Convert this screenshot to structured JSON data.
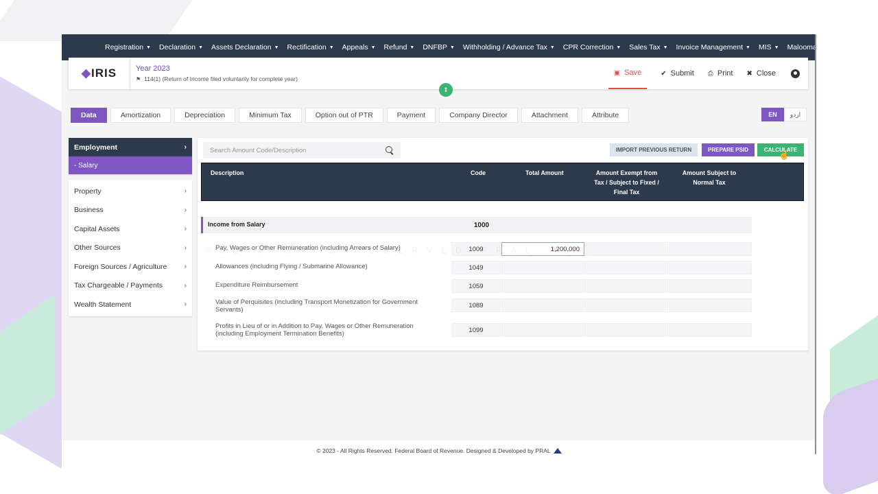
{
  "nav": {
    "items": [
      {
        "label": "Registration"
      },
      {
        "label": "Declaration"
      },
      {
        "label": "Assets Declaration"
      },
      {
        "label": "Rectification"
      },
      {
        "label": "Appeals"
      },
      {
        "label": "Refund"
      },
      {
        "label": "DNFBP"
      },
      {
        "label": "Withholding / Advance Tax"
      },
      {
        "label": "CPR Correction"
      },
      {
        "label": "Sales Tax"
      },
      {
        "label": "Invoice Management"
      },
      {
        "label": "MIS"
      },
      {
        "label": "Maloomat"
      }
    ]
  },
  "header": {
    "logo": "IRIS",
    "year": "Year 2023",
    "return_type": "114(1) (Return of Income filed voluntarily for complete year)",
    "save": "Save",
    "submit": "Submit",
    "print": "Print",
    "close": "Close"
  },
  "tabs": [
    "Data",
    "Amortization",
    "Depreciation",
    "Minimum Tax",
    "Option out of PTR",
    "Payment",
    "Company Director",
    "Attachment",
    "Attribute"
  ],
  "lang": {
    "en": "EN",
    "ur": "اردو"
  },
  "sidebar": {
    "head": "Employment",
    "sub": "- Salary",
    "items": [
      "Property",
      "Business",
      "Capital Assets",
      "Other Sources",
      "Foreign Sources / Agriculture",
      "Tax Chargeable / Payments",
      "Wealth Statement"
    ]
  },
  "search": {
    "placeholder": "Search Amount Code/Description"
  },
  "buttons": {
    "import": "Import Previous Return",
    "psid": "Prepare PSID",
    "calculate": "Calculate"
  },
  "table": {
    "headers": {
      "description": "Description",
      "code": "Code",
      "total": "Total Amount",
      "exempt": "Amount Exempt from Tax / Subject to Fixed / Final Tax",
      "normal": "Amount Subject to Normal Tax"
    },
    "group": {
      "label": "Income from Salary",
      "code": "1000"
    },
    "rows": [
      {
        "desc": "Pay, Wages or Other Remuneration (including Arrears of Salary)",
        "code": "1009",
        "total": "1,200,000"
      },
      {
        "desc": "Allowances (including Flying / Submarine Allowance)",
        "code": "1049",
        "total": ""
      },
      {
        "desc": "Expenditure Reimbursement",
        "code": "1059",
        "total": ""
      },
      {
        "desc": "Value of Perquisites (including Transport Monetization for Government Servants)",
        "code": "1089",
        "total": ""
      },
      {
        "desc": "Profits in Lieu of or in Addition to Pay, Wages or Other Remuneration (including Employment Termination Benefits)",
        "code": "1099",
        "total": ""
      }
    ]
  },
  "watermark": "ALL RIGHTS RESERVED PRAL FBR",
  "footer": "© 2023 - All Rights Reserved. Federal Board of Revenue. Designed & Developed by PRAL",
  "colors": {
    "nav": "#2c3a4b",
    "accent": "#7e57c2",
    "success": "#3cb371",
    "danger": "#d9534f"
  }
}
